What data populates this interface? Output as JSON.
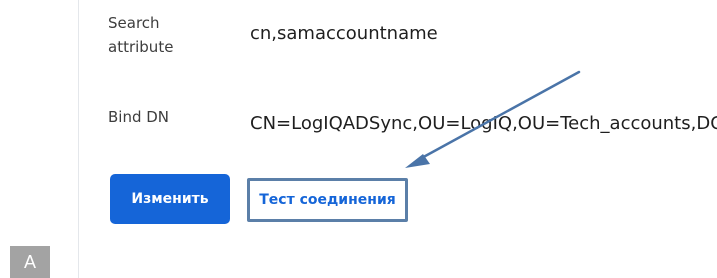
{
  "sidebar": {
    "avatar_letter": "A"
  },
  "fields": {
    "search_attribute": {
      "label_line1": "Search",
      "label_line2": "attribute",
      "value": "cn,samaccountname"
    },
    "bind_dn": {
      "label": "Bind DN",
      "value": "CN=LogIQADSync,OU=LogIQ,OU=Tech_accounts,DC"
    }
  },
  "actions": {
    "edit_label": "Изменить",
    "test_connection_label": "Тест соединения"
  },
  "annotation": {
    "arrow_color": "#4a74a8",
    "arrow_target": "test-connection-button"
  },
  "colors": {
    "primary": "#1565d8",
    "highlight_border": "#5b7fa8",
    "avatar_bg": "#a3a3a3"
  }
}
